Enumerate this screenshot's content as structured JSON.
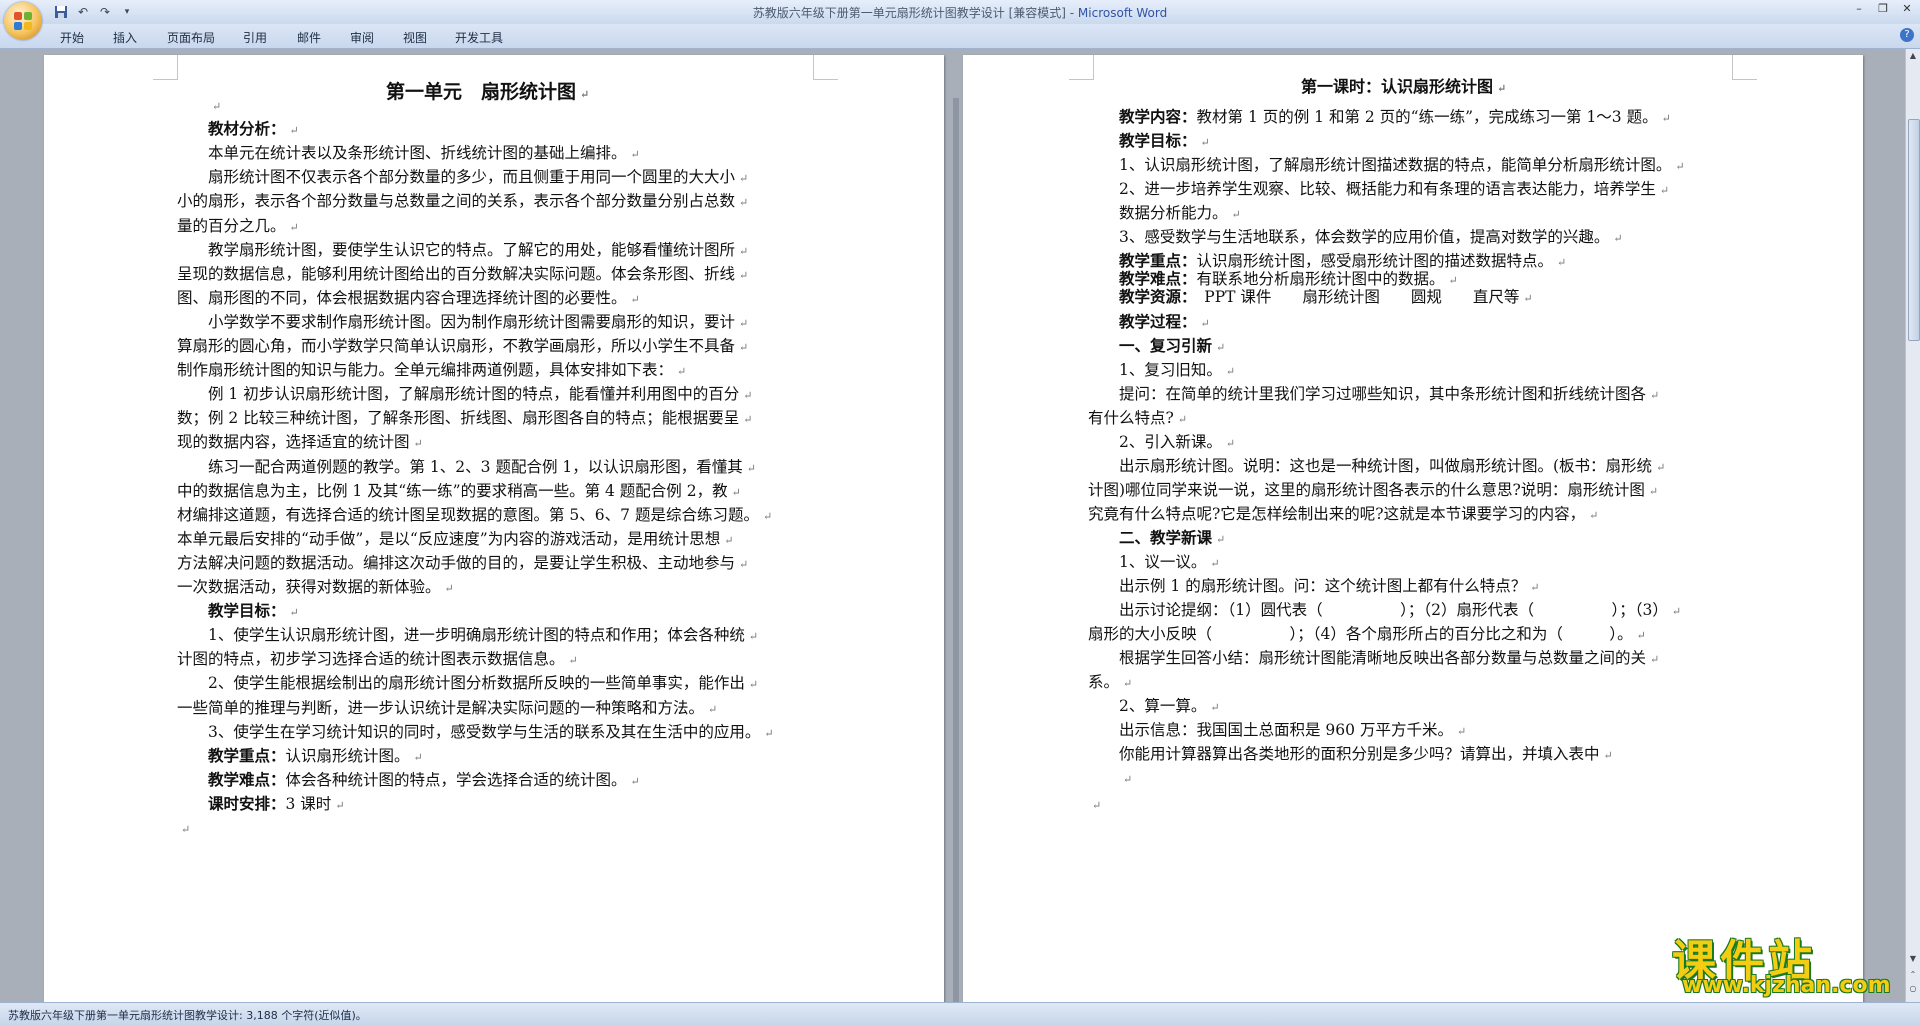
{
  "window": {
    "title_doc": "苏教版六年级下册第一单元扇形统计图教学设计 [兼容模式] - ",
    "title_app": "Microsoft Word"
  },
  "ribbon": {
    "tabs": [
      "开始",
      "插入",
      "页面布局",
      "引用",
      "邮件",
      "审阅",
      "视图",
      "开发工具"
    ]
  },
  "left_page": {
    "title": "第一单元　扇形统计图",
    "lines": [
      {
        "text": "",
        "indent": 2
      },
      {
        "bold": "教材分析：",
        "text": "",
        "indent": 2
      },
      {
        "text": "本单元在统计表以及条形统计图、折线统计图的基础上编排。",
        "indent": 2
      },
      {
        "text": "扇形统计图不仅表示各个部分数量的多少，而且侧重于用同一个圆里的大大小",
        "indent": 2
      },
      {
        "text": "小的扇形，表示各个部分数量与总数量之间的关系，表示各个部分数量分别占总数",
        "indent": 0
      },
      {
        "text": "量的百分之几。",
        "indent": 0
      },
      {
        "text": "教学扇形统计图，要使学生认识它的特点。了解它的用处，能够看懂统计图所",
        "indent": 2
      },
      {
        "text": "呈现的数据信息，能够利用统计图给出的百分数解决实际问题。体会条形图、折线",
        "indent": 0
      },
      {
        "text": "图、扇形图的不同，体会根据数据内容合理选择统计图的必要性。",
        "indent": 0
      },
      {
        "text": "小学数学不要求制作扇形统计图。因为制作扇形统计图需要扇形的知识，要计",
        "indent": 2
      },
      {
        "text": "算扇形的圆心角，而小学数学只简单认识扇形，不教学画扇形，所以小学生不具备",
        "indent": 0
      },
      {
        "text": "制作扇形统计图的知识与能力。全单元编排两道例题，具体安排如下表：",
        "indent": 0
      },
      {
        "text": "例 1 初步认识扇形统计图，了解扇形统计图的特点，能看懂并利用图中的百分",
        "indent": 2
      },
      {
        "text": "数；例 2 比较三种统计图，了解条形图、折线图、扇形图各自的特点；能根据要呈",
        "indent": 0
      },
      {
        "text": "现的数据内容，选择适宜的统计图",
        "indent": 0
      },
      {
        "text": "练习一配合两道例题的教学。第 1、2、3 题配合例 1，以认识扇形图，看懂其",
        "indent": 2
      },
      {
        "text": "中的数据信息为主，比例 1 及其“练一练”的要求稍高一些。第 4 题配合例 2，教",
        "indent": 0
      },
      {
        "text": "材编排这道题，有选择合适的统计图呈现数据的意图。第 5、6、7 题是综合练习题。",
        "indent": 0
      },
      {
        "text": "本单元最后安排的“动手做”，是以“反应速度”为内容的游戏活动，是用统计思想",
        "indent": 0
      },
      {
        "text": "方法解决问题的数据活动。编排这次动手做的目的，是要让学生积极、主动地参与",
        "indent": 0
      },
      {
        "text": "一次数据活动，获得对数据的新体验。",
        "indent": 0
      },
      {
        "bold": "教学目标：",
        "text": "",
        "indent": 2
      },
      {
        "text": "1、使学生认识扇形统计图，进一步明确扇形统计图的特点和作用；体会各种统",
        "indent": 2
      },
      {
        "text": "计图的特点，初步学习选择合适的统计图表示数据信息。",
        "indent": 0
      },
      {
        "text": "2、使学生能根据绘制出的扇形统计图分析数据所反映的一些简单事实，能作出",
        "indent": 2
      },
      {
        "text": "一些简单的推理与判断，进一步认识统计是解决实际问题的一种策略和方法。",
        "indent": 0
      },
      {
        "text": "3、使学生在学习统计知识的同时，感受数学与生活的联系及其在生活中的应用。",
        "indent": 2
      },
      {
        "bold": "教学重点：",
        "text": "认识扇形统计图。",
        "indent": 2
      },
      {
        "bold": "教学难点：",
        "text": "体会各种统计图的特点，学会选择合适的统计图。",
        "indent": 2
      },
      {
        "bold": "课时安排：",
        "text": "3 课时",
        "indent": 2
      },
      {
        "text": "",
        "indent": 0
      }
    ]
  },
  "right_page": {
    "title": "第一课时：认识扇形统计图",
    "lines": [
      {
        "bold": "教学内容：",
        "text": "教材第 1 页的例 1 和第 2 页的“练一练”，完成练习一第 1～3 题。",
        "indent": 2
      },
      {
        "bold": "教学目标：",
        "text": "",
        "indent": 2
      },
      {
        "text": "1、认识扇形统计图，了解扇形统计图描述数据的特点，能简单分析扇形统计图。",
        "indent": 2
      },
      {
        "text": "2、进一步培养学生观察、比较、概括能力和有条理的语言表达能力，培养学生",
        "indent": 2
      },
      {
        "text": "数据分析能力。",
        "indent": 2
      },
      {
        "text": "3、感受数学与生活地联系，体会数学的应用价值，提高对数学的兴趣。",
        "indent": 2
      },
      {
        "bold": "教学重点：",
        "text": "认识扇形统计图，感受扇形统计图的描述数据特点。",
        "indent": 2
      },
      {
        "bold": "教学难点：",
        "text": "有联系地分析扇形统计图中的数据。",
        "indent": 2
      },
      {
        "bold": "教学资源：",
        "text": "　PPT 课件　　扇形统计图　　圆规　　直尺等",
        "indent": 2
      },
      {
        "bold": "教学过程：",
        "text": "",
        "indent": 2
      },
      {
        "bold": "一、复习引新",
        "text": "",
        "indent": 2
      },
      {
        "text": "1、复习旧知。",
        "indent": 2
      },
      {
        "text": "提问：在简单的统计里我们学习过哪些知识，其中条形统计图和折线统计图各",
        "indent": 2
      },
      {
        "text": "有什么特点?",
        "indent": 0
      },
      {
        "text": "2、引入新课。",
        "indent": 2
      },
      {
        "text": "出示扇形统计图。说明：这也是一种统计图，叫做扇形统计图。(板书：扇形统",
        "indent": 2
      },
      {
        "text": "计图)哪位同学来说一说，这里的扇形统计图各表示的什么意思?说明：扇形统计图",
        "indent": 0
      },
      {
        "text": "究竟有什么特点呢?它是怎样绘制出来的呢?这就是本节课要学习的内容，",
        "indent": 0
      },
      {
        "bold": "二、教学新课",
        "text": "",
        "indent": 2
      },
      {
        "text": "1、议一议。",
        "indent": 2
      },
      {
        "text": "出示例 1 的扇形统计图。问：这个统计图上都有什么特点？",
        "indent": 2
      },
      {
        "text": "出示讨论提纲：（1）圆代表（　　　　　）；（2）扇形代表（　　　　　）；（3）",
        "indent": 2
      },
      {
        "text": "扇形的大小反映（　　　　　）；（4）各个扇形所占的百分比之和为（　　　）。",
        "indent": 0
      },
      {
        "text": " 根据学生回答小结：扇形统计图能清晰地反映出各部分数量与总数量之间的关",
        "indent": 2
      },
      {
        "text": "系。",
        "indent": 0
      },
      {
        "text": "2、算一算。",
        "indent": 2
      },
      {
        "text": "出示信息：我国国土总面积是 960 万平方千米。",
        "indent": 2
      },
      {
        "text": "你能用计算器算出各类地形的面积分别是多少吗？请算出，并填入表中",
        "indent": 2
      },
      {
        "text": "",
        "indent": 2
      },
      {
        "text": "",
        "indent": 0
      }
    ]
  },
  "status": {
    "text": "苏教版六年级下册第一单元扇形统计图教学设计: 3,188 个字符(近似值)。"
  },
  "watermark": {
    "text": "课件站",
    "url": "www.kjzhan.com"
  },
  "icons": {
    "office_button": "office-logo-icon",
    "save": "save-icon",
    "undo": "undo-icon",
    "redo": "redo-icon",
    "paragraph_mark": "paragraph-mark-icon"
  }
}
